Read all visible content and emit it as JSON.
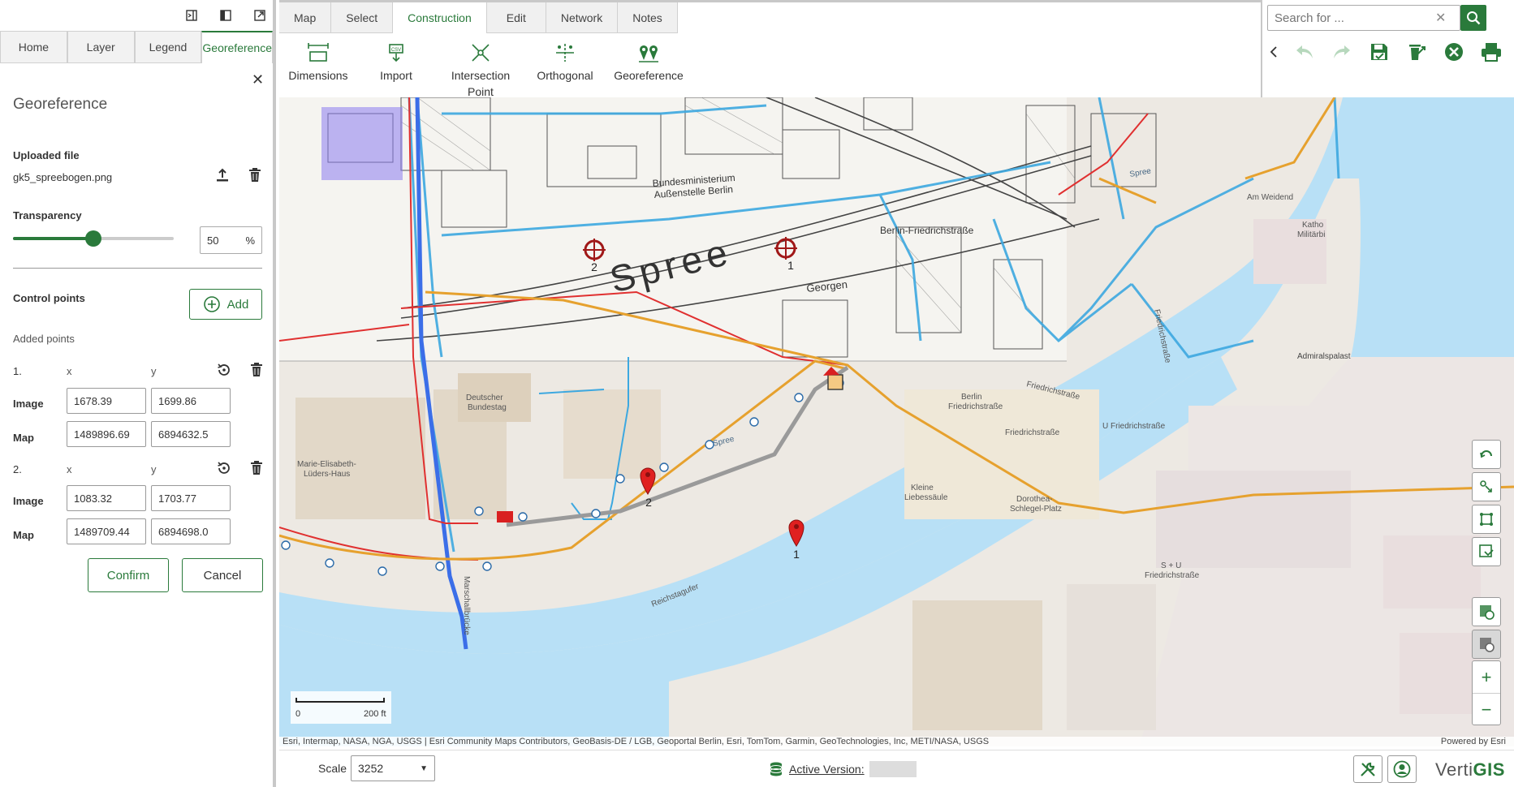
{
  "left_panel": {
    "tabs": [
      {
        "label": "Home",
        "active": false
      },
      {
        "label": "Layer",
        "active": false
      },
      {
        "label": "Legend",
        "active": false
      },
      {
        "label": "Georeference",
        "active": true
      }
    ],
    "title": "Georeference",
    "uploaded_file_label": "Uploaded file",
    "uploaded_file_name": "gk5_spreebogen.png",
    "transparency_label": "Transparency",
    "transparency_value": "50",
    "transparency_unit": "%",
    "transparency_percent": 50,
    "control_points_label": "Control points",
    "add_label": "Add",
    "added_points_label": "Added points",
    "x_label": "x",
    "y_label": "y",
    "image_label": "Image",
    "map_label": "Map",
    "points": [
      {
        "index": "1.",
        "image_x": "1678.39",
        "image_y": "1699.86",
        "map_x": "1489896.69",
        "map_y": "6894632.5"
      },
      {
        "index": "2.",
        "image_x": "1083.32",
        "image_y": "1703.77",
        "map_x": "1489709.44",
        "map_y": "6894698.0"
      }
    ],
    "confirm_label": "Confirm",
    "cancel_label": "Cancel"
  },
  "ribbon": {
    "tabs": [
      {
        "label": "Map",
        "active": false
      },
      {
        "label": "Select",
        "active": false
      },
      {
        "label": "Construction",
        "active": true
      },
      {
        "label": "Edit",
        "active": false
      },
      {
        "label": "Network",
        "active": false
      },
      {
        "label": "Notes",
        "active": false
      }
    ],
    "tools": {
      "dimensions": "Dimensions",
      "import": "Import",
      "intersection_line1": "Intersection",
      "intersection_line2": "Point",
      "orthogonal": "Orthogonal",
      "georeference": "Georeference"
    }
  },
  "search": {
    "placeholder": "Search for ..."
  },
  "map": {
    "labels": {
      "spree_big": "Spree",
      "marker1": "1",
      "marker2": "2",
      "target1": "1",
      "target2": "2",
      "bundesministerium": "Bundesministerium",
      "aussenstelle": "Außenstelle Berlin",
      "friedrichstrasse_station": "Berlin-Friedrichstraße",
      "georgen": "Georgen",
      "deutscher_bundestag_1": "Deutscher",
      "deutscher_bundestag_2": "Bundestag",
      "marie_1": "Marie-Elisabeth-",
      "marie_2": "Lüders-Haus",
      "kleine_1": "Kleine",
      "kleine_2": "Liebessäule",
      "dorothea_1": "Dorothea-",
      "dorothea_2": "Schlegel-Platz",
      "admiralspalast": "Admiralspalast",
      "friedrichstrasse_road": "Friedrichstraße",
      "berlin_fs_1": "Berlin",
      "berlin_fs_2": "Friedrichstraße",
      "u_friedrichstrasse": "U Friedrichstraße",
      "friedrichstrasse_3": "Friedrichstraße",
      "su_1": "S + U",
      "su_2": "Friedrichstraße",
      "spree_label_1": "Spree",
      "spree_label_2": "Spree",
      "reichstagufer": "Reichstagufer",
      "marschallbruecke": "Marschallbrücke",
      "am_weidend": "Am Weidend",
      "friedrichstrasse_vert": "Friedrichstraße",
      "katho_1": "Katho",
      "katho_2": "Militärbi"
    },
    "scalebar_start": "0",
    "scalebar_end": "200 ft",
    "attribution": "Esri, Intermap, NASA, NGA, USGS | Esri Community Maps Contributors, GeoBasis-DE / LGB, Geoportal Berlin, Esri, TomTom, Garmin, GeoTechnologies, Inc, METI/NASA, USGS",
    "powered_by": "Powered by Esri"
  },
  "bottom": {
    "scale_label": "Scale",
    "scale_value": "3252",
    "active_version_label": "Active Version:",
    "brand_prefix": "Verti",
    "brand_suffix": "GIS"
  },
  "colors": {
    "accent": "#2a7a3b",
    "water": "#b8e0f6",
    "pipe_blue": "#3da8e0",
    "main_red": "#e03030",
    "orange": "#e6a12e"
  }
}
